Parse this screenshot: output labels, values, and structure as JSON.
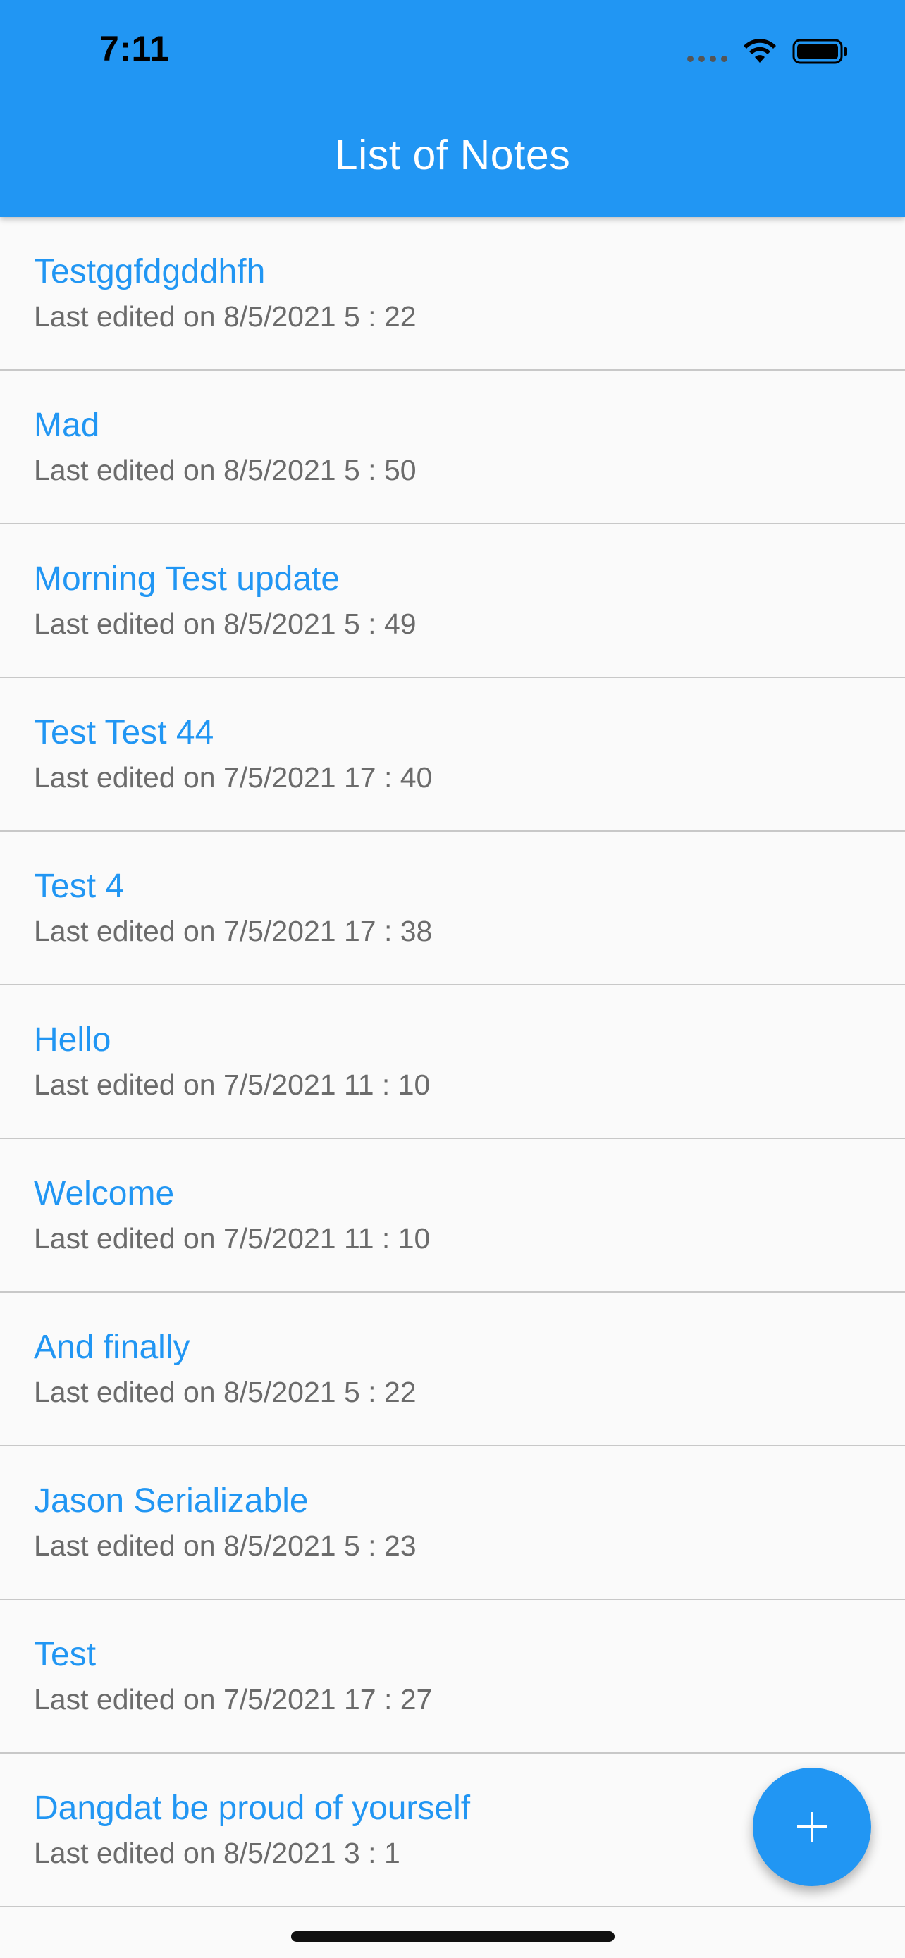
{
  "status_bar": {
    "time": "7:11"
  },
  "header": {
    "title": "List of Notes"
  },
  "colors": {
    "primary": "#2196f3",
    "background": "#fafafa",
    "subtitle": "#6b6b6b",
    "divider": "#c8c8c8"
  },
  "notes": [
    {
      "title": "Testggfdgddhfh",
      "subtitle": "Last edited on 8/5/2021 5 : 22"
    },
    {
      "title": "Mad",
      "subtitle": "Last edited on 8/5/2021 5 : 50"
    },
    {
      "title": "Morning Test update",
      "subtitle": "Last edited on 8/5/2021 5 : 49"
    },
    {
      "title": "Test Test 44",
      "subtitle": "Last edited on 7/5/2021 17 : 40"
    },
    {
      "title": "Test 4",
      "subtitle": "Last edited on 7/5/2021 17 : 38"
    },
    {
      "title": "Hello",
      "subtitle": "Last edited on 7/5/2021 11 : 10"
    },
    {
      "title": "Welcome",
      "subtitle": "Last edited on 7/5/2021 11 : 10"
    },
    {
      "title": "And finally",
      "subtitle": "Last edited on 8/5/2021 5 : 22"
    },
    {
      "title": "Jason Serializable",
      "subtitle": "Last edited on 8/5/2021 5 : 23"
    },
    {
      "title": "Test",
      "subtitle": "Last edited on 7/5/2021 17 : 27"
    },
    {
      "title": "Dangdat be proud of yourself",
      "subtitle": "Last edited on 8/5/2021 3 : 1"
    }
  ],
  "icons": {
    "fab": "plus-icon",
    "wifi": "wifi-icon",
    "battery": "battery-icon",
    "signal": "signal-icon"
  }
}
